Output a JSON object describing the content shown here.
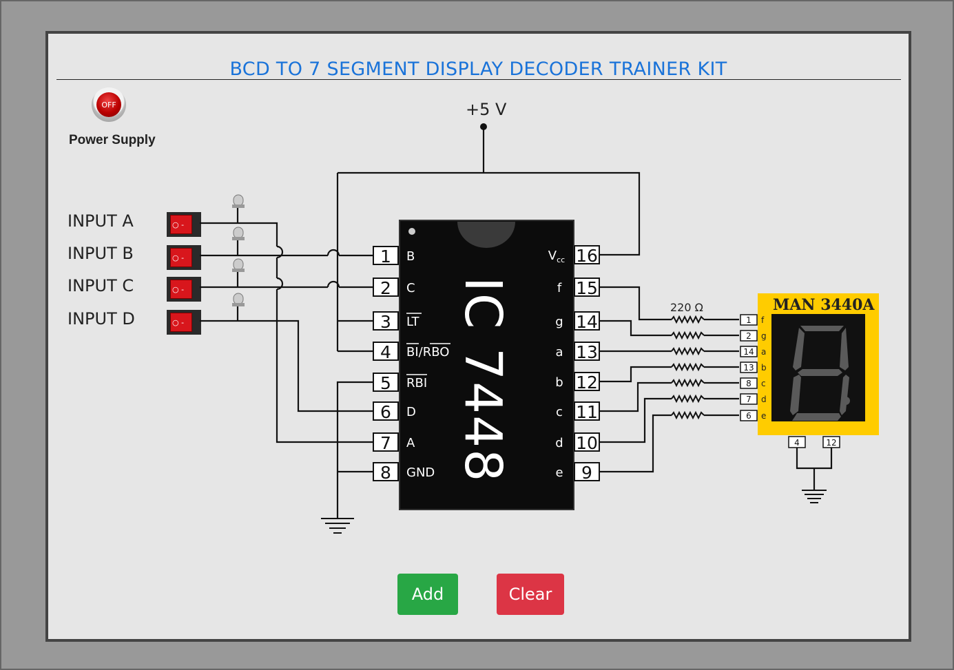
{
  "title": "BCD TO 7 SEGMENT DISPLAY DECODER TRAINER KIT",
  "power": {
    "button_label": "OFF",
    "label": "Power Supply"
  },
  "inputs": [
    {
      "label": "INPUT A"
    },
    {
      "label": "INPUT B"
    },
    {
      "label": "INPUT C"
    },
    {
      "label": "INPUT D"
    }
  ],
  "supply_label": "+5 V",
  "ic": {
    "name": "IC 7448",
    "left_pins": [
      {
        "num": "1",
        "name": "B"
      },
      {
        "num": "2",
        "name": "C"
      },
      {
        "num": "3",
        "name": "LT"
      },
      {
        "num": "4",
        "name": "BI/RBO"
      },
      {
        "num": "5",
        "name": "RBI"
      },
      {
        "num": "6",
        "name": "D"
      },
      {
        "num": "7",
        "name": "A"
      },
      {
        "num": "8",
        "name": "GND"
      }
    ],
    "right_pins": [
      {
        "num": "16",
        "name": "V",
        "sub": "cc"
      },
      {
        "num": "15",
        "name": "f"
      },
      {
        "num": "14",
        "name": "g"
      },
      {
        "num": "13",
        "name": "a"
      },
      {
        "num": "12",
        "name": "b"
      },
      {
        "num": "11",
        "name": "c"
      },
      {
        "num": "10",
        "name": "d"
      },
      {
        "num": "9",
        "name": "e"
      }
    ]
  },
  "resistor_label": "220 Ω",
  "display": {
    "name": "MAN 3440A",
    "pins": [
      {
        "num": "1",
        "seg": "f"
      },
      {
        "num": "2",
        "seg": "g"
      },
      {
        "num": "14",
        "seg": "a"
      },
      {
        "num": "13",
        "seg": "b"
      },
      {
        "num": "8",
        "seg": "c"
      },
      {
        "num": "7",
        "seg": "d"
      },
      {
        "num": "6",
        "seg": "e"
      }
    ],
    "bottom_pins": [
      "4",
      "12"
    ]
  },
  "buttons": {
    "add": "Add",
    "clear": "Clear"
  },
  "colors": {
    "title": "#1a73d9",
    "add": "#28a745",
    "clear": "#dc3545",
    "display_body": "#ffcc00",
    "switch": "#d8161c"
  }
}
